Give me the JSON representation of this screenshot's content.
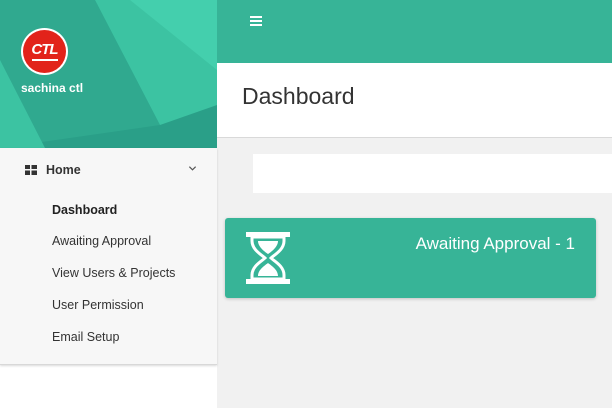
{
  "colors": {
    "primary": "#37b497",
    "header_dark": "#2a9f88",
    "logo_red": "#e2231a"
  },
  "user": {
    "name": "sachina ctl",
    "avatar_logo_text": "CTL",
    "avatar_icon": "company-logo"
  },
  "topbar": {
    "menu_icon": "hamburger-icon"
  },
  "sidebar": {
    "home": {
      "label": "Home",
      "icon": "grid-icon",
      "expand_icon": "chevron-down-icon"
    },
    "items": [
      {
        "label": "Dashboard",
        "active": true
      },
      {
        "label": "Awaiting Approval",
        "active": false
      },
      {
        "label": "View Users & Projects",
        "active": false
      },
      {
        "label": "User Permission",
        "active": false
      },
      {
        "label": "Email Setup",
        "active": false
      }
    ]
  },
  "page": {
    "title": "Dashboard"
  },
  "card": {
    "label": "Awaiting Approval - 1",
    "icon": "hourglass-icon"
  }
}
